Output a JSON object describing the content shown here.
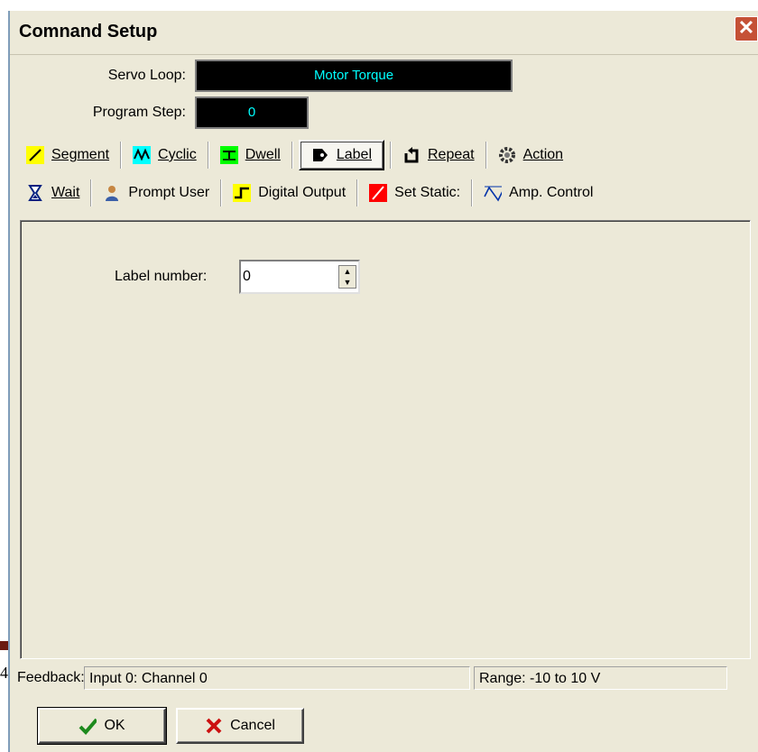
{
  "window": {
    "title": "Comnand Setup",
    "close_glyph": "✕"
  },
  "fields": {
    "servo_loop_label": "Servo Loop:",
    "servo_loop_value": "Motor Torque",
    "program_step_label": "Program Step:",
    "program_step_value": "0"
  },
  "toolbar": {
    "row1": [
      {
        "label": "Segment",
        "icon": "segment-icon",
        "color": "#ffff00"
      },
      {
        "label": "Cyclic",
        "icon": "cyclic-icon",
        "color": "#00ffff"
      },
      {
        "label": "Dwell",
        "icon": "dwell-icon",
        "color": "#00ff00"
      },
      {
        "label": "Label",
        "icon": "label-icon",
        "active": true
      },
      {
        "label": "Repeat",
        "icon": "repeat-icon"
      },
      {
        "label": "Action",
        "icon": "gear-icon"
      }
    ],
    "row2": [
      {
        "label": "Wait",
        "icon": "hourglass-icon"
      },
      {
        "label": "Prompt User",
        "icon": "user-icon"
      },
      {
        "label": "Digital Output",
        "icon": "digital-output-icon",
        "color": "#ffff00"
      },
      {
        "label": "Set Static:",
        "icon": "set-static-icon",
        "color": "#ff0000"
      },
      {
        "label": "Amp. Control",
        "icon": "amp-control-icon"
      }
    ]
  },
  "panel": {
    "label_number_label": "Label number:",
    "label_number_value": "0"
  },
  "status": {
    "feedback_label": "Feedback:",
    "feedback_value": "Input 0: Channel 0",
    "range_value": "Range: -10 to 10 V"
  },
  "buttons": {
    "ok": "OK",
    "cancel": "Cancel"
  },
  "page_edge": {
    "digit": "4"
  }
}
